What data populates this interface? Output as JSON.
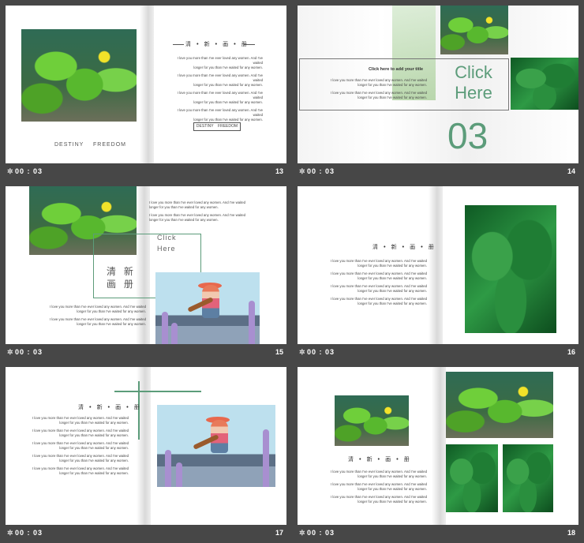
{
  "duration": "00 : 03",
  "lorem": "I love you more than I've ever loved any women. And I've waited longer for you than I've waited for any women.",
  "lorem_a": "I love you more than I've ever loved any women. And I've waited",
  "lorem_b": "longer for you than I've waited for any women.",
  "heading": "清 • 新 • 画 • 册",
  "slides": [
    {
      "num": "13",
      "tag": "DESTINY    FREEDOM",
      "button": "DESTINY    FREEDOM"
    },
    {
      "num": "14",
      "title": "Click here to add your title",
      "click1": "Click",
      "click2": "Here",
      "big": "03"
    },
    {
      "num": "15",
      "click1": "Click",
      "click2": "Here",
      "cn1": "清 新",
      "cn2": "画 册"
    },
    {
      "num": "16"
    },
    {
      "num": "17"
    },
    {
      "num": "18"
    }
  ]
}
